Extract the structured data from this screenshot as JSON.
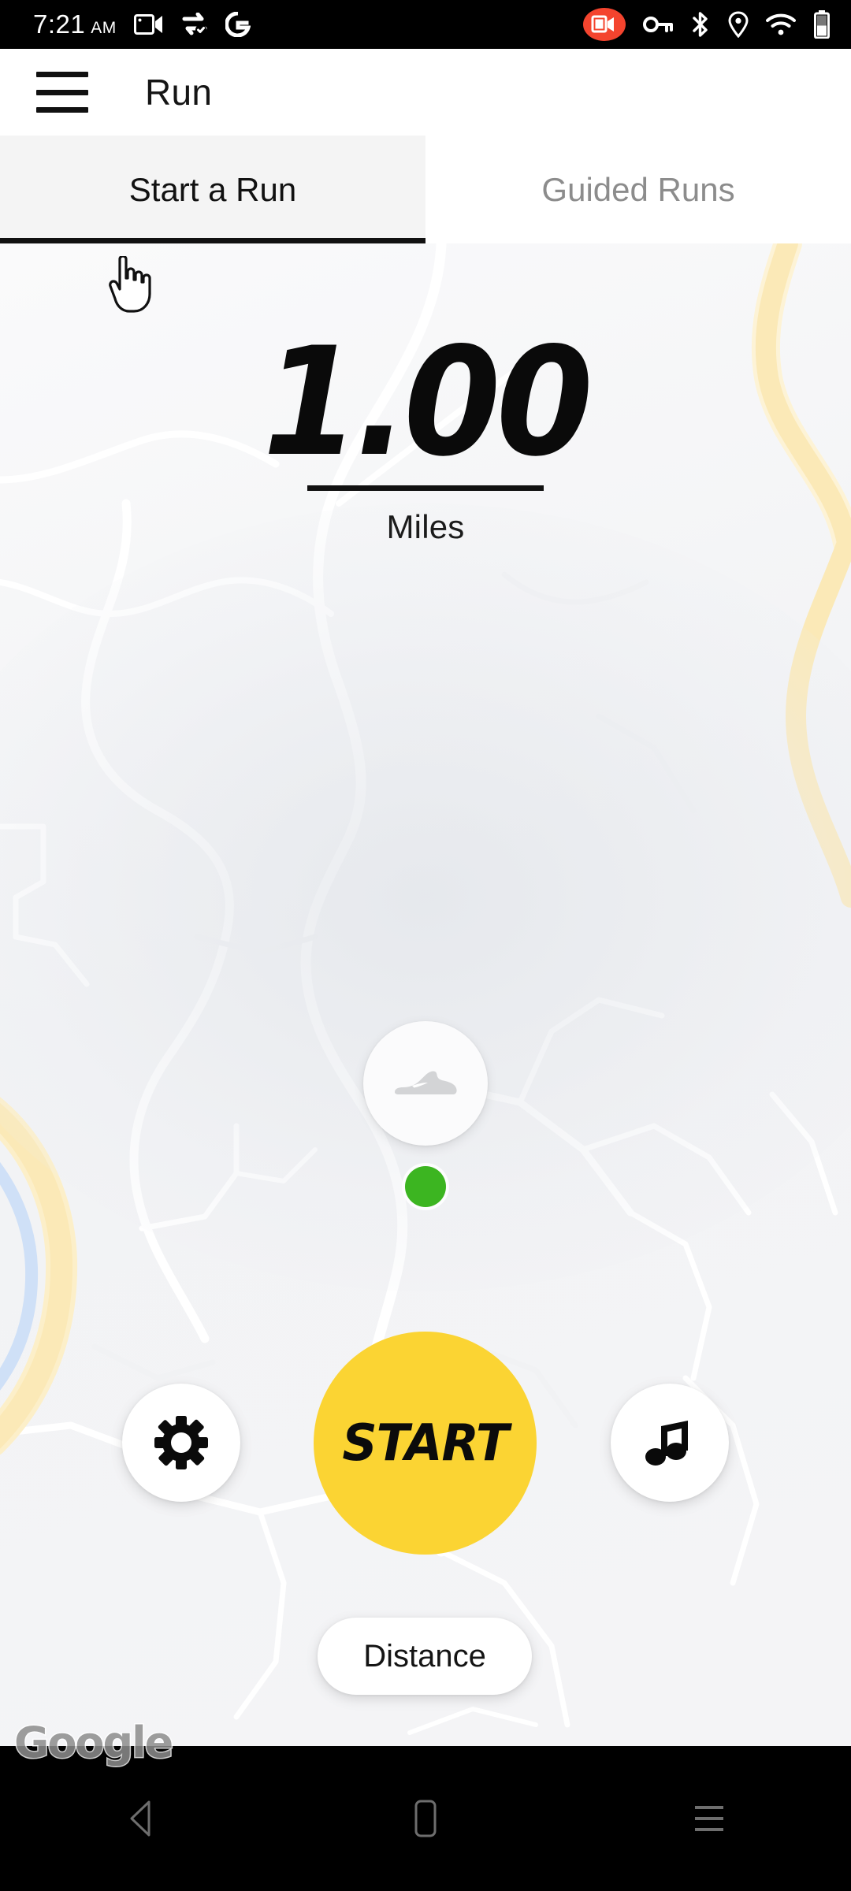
{
  "status_bar": {
    "time": "7:21",
    "ampm": "AM",
    "icons_left": [
      "video-camera-icon",
      "data-saver-icon",
      "google-g-icon"
    ],
    "icons_right": [
      "screen-recording-active-icon",
      "vpn-key-icon",
      "bluetooth-icon",
      "location-icon",
      "wifi-icon",
      "battery-icon"
    ],
    "recording_badge_color": "#f4442e"
  },
  "app_bar": {
    "menu_icon": "hamburger-menu-icon",
    "title": "Run"
  },
  "tabs": [
    {
      "label": "Start a Run",
      "active": true
    },
    {
      "label": "Guided Runs",
      "active": false
    }
  ],
  "map": {
    "watermark": "Google",
    "gps_status_color": "#3cb521",
    "shoe_icon": "running-shoe-icon"
  },
  "readout": {
    "value": "1.00",
    "unit": "Miles"
  },
  "controls": {
    "settings_label": "settings-gear-icon",
    "start_label": "START",
    "music_label": "music-note-icon",
    "metric_pill": "Distance",
    "start_color": "#fbd433"
  },
  "nav_bar": {
    "back": "back-triangle-icon",
    "home": "home-square-icon",
    "recents": "recents-lines-icon"
  }
}
